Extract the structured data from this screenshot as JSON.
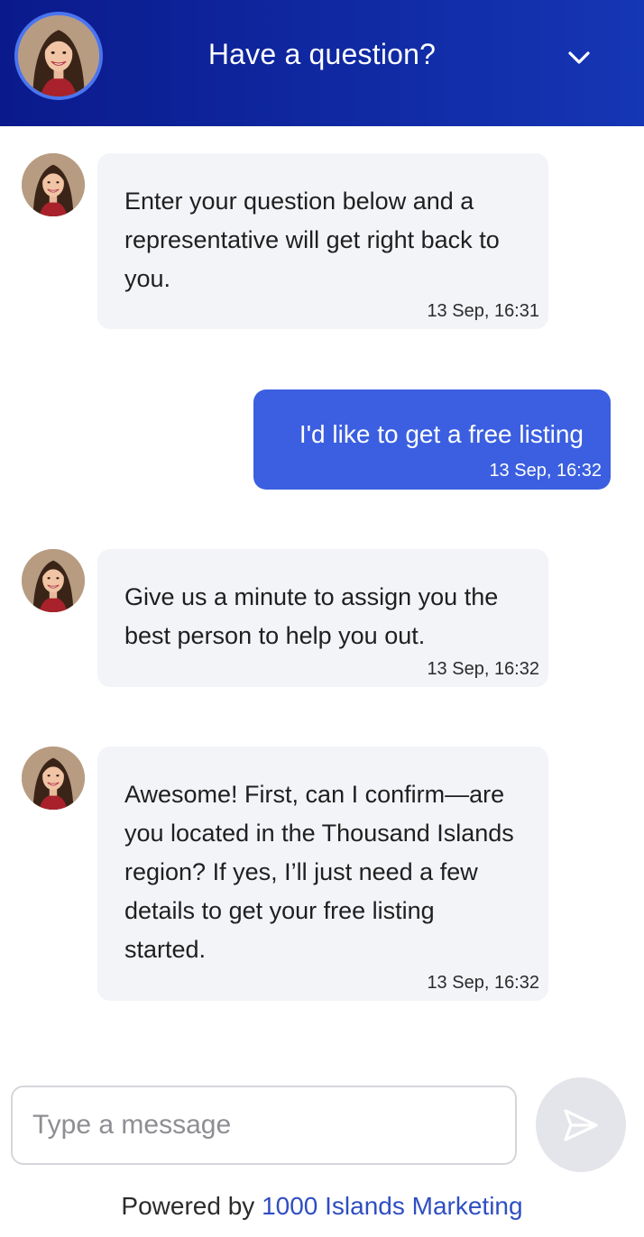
{
  "header": {
    "title": "Have a question?",
    "avatar_icon": "agent-avatar",
    "collapse_icon": "chevron-down-icon"
  },
  "messages": [
    {
      "from": "agent",
      "text": "Enter your question below and a representative will get right back to you.",
      "time": "13 Sep, 16:31"
    },
    {
      "from": "user",
      "text": "I'd like to get a free listing",
      "time": "13 Sep, 16:32"
    },
    {
      "from": "agent",
      "text": "Give us a minute to assign you the best person to help you out.",
      "time": "13 Sep, 16:32"
    },
    {
      "from": "agent",
      "text": "Awesome! First, can I confirm—are you located in the Thousand Islands region? If yes, I’ll just need a few details to get your free listing started.",
      "time": "13 Sep, 16:32"
    }
  ],
  "composer": {
    "placeholder": "Type a message",
    "value": "",
    "send_icon": "send-icon"
  },
  "footer": {
    "powered_by": "Powered by",
    "brand": "1000 Islands Marketing"
  },
  "colors": {
    "header_start": "#0a1a8c",
    "header_end": "#1536b5",
    "user_bubble": "#3b5fe0",
    "agent_bubble": "#f3f4f8",
    "link": "#2f4ec2"
  }
}
